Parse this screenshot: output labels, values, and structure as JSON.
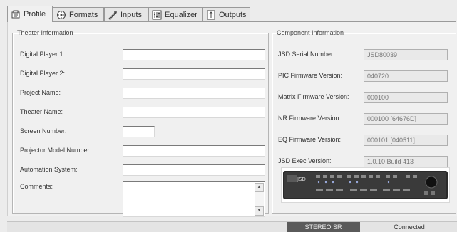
{
  "tabs": [
    {
      "label": "Profile",
      "icon": "profile-icon"
    },
    {
      "label": "Formats",
      "icon": "formats-icon"
    },
    {
      "label": "Inputs",
      "icon": "inputs-icon"
    },
    {
      "label": "Equalizer",
      "icon": "equalizer-icon"
    },
    {
      "label": "Outputs",
      "icon": "outputs-icon"
    }
  ],
  "theater": {
    "title": "Theater Information",
    "fields": [
      {
        "label": "Digital Player 1:",
        "value": ""
      },
      {
        "label": "Digital Player 2:",
        "value": ""
      },
      {
        "label": "Project Name:",
        "value": ""
      },
      {
        "label": "Theater Name:",
        "value": ""
      },
      {
        "label": "Screen Number:",
        "value": ""
      },
      {
        "label": "Projector Model Number:",
        "value": ""
      },
      {
        "label": "Automation System:",
        "value": ""
      },
      {
        "label": "Comments:",
        "value": ""
      }
    ]
  },
  "component": {
    "title": "Component Information",
    "fields": [
      {
        "label": "JSD Serial Number:",
        "value": "JSD80039"
      },
      {
        "label": "PIC Firmware Version:",
        "value": "040720"
      },
      {
        "label": "Matrix Firmware Version:",
        "value": "000100"
      },
      {
        "label": "NR Firmware Version:",
        "value": "000100  [64676D]"
      },
      {
        "label": "EQ Firmware Version:",
        "value": "000101  [040511]"
      },
      {
        "label": "JSD Exec Version:",
        "value": "1.0.10 Build 413"
      }
    ],
    "device_logo": "JSD"
  },
  "status": {
    "format": "STEREO SR",
    "connection": "Connected"
  }
}
